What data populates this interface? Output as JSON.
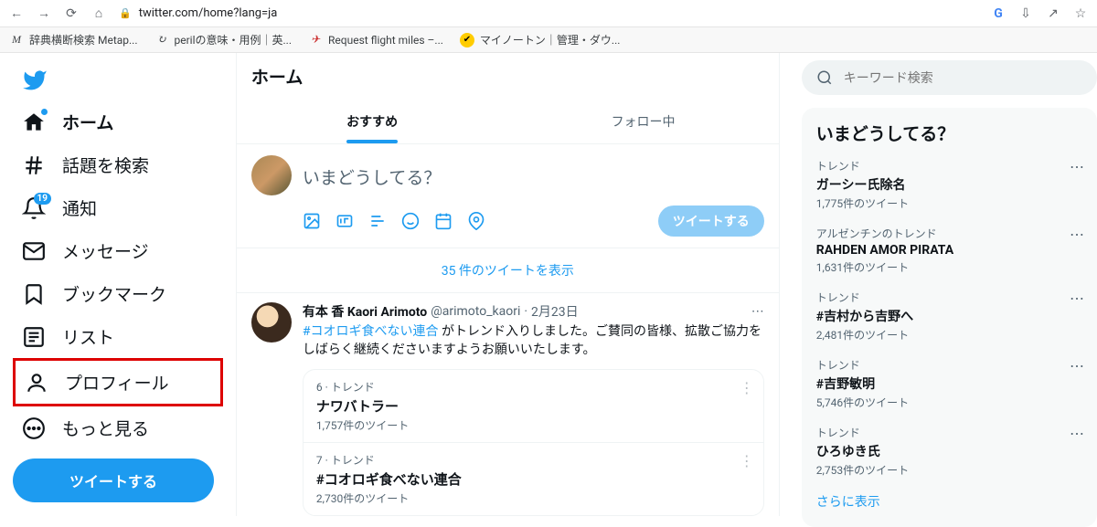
{
  "browser": {
    "url": "twitter.com/home?lang=ja",
    "bookmarks": [
      {
        "icon": "M",
        "label": "辞典横断検索 Metap..."
      },
      {
        "icon": "↻",
        "label": "perilの意味・用例｜英..."
      },
      {
        "icon": "✈",
        "label": "Request flight miles –..."
      },
      {
        "icon": "✔",
        "label": "マイノートン｜管理・ダウ..."
      }
    ]
  },
  "nav": {
    "home": "ホーム",
    "explore": "話題を検索",
    "notifications": "通知",
    "notifications_badge": "19",
    "messages": "メッセージ",
    "bookmarks": "ブックマーク",
    "lists": "リスト",
    "profile": "プロフィール",
    "more": "もっと見る",
    "tweet_button": "ツイートする"
  },
  "center": {
    "title": "ホーム",
    "tabs": {
      "for_you": "おすすめ",
      "following": "フォロー中"
    },
    "compose_placeholder": "いまどうしてる？",
    "tweet_button": "ツイートする",
    "show_new": "35 件のツイートを表示",
    "tweet": {
      "name": "有本 香 Kaori Arimoto",
      "handle": "@arimoto_kaori",
      "date": "2月23日",
      "hashtag": "#コオロギ食べない連合",
      "text_after": " がトレンド入りしました。ご賛同の皆様、拡散ご協力をしばらく継続くださいますようお願いいたします。"
    },
    "embedded_trends": [
      {
        "rank": "6 · トレンド",
        "name": "ナワバトラー",
        "count": "1,757件のツイート"
      },
      {
        "rank": "7 · トレンド",
        "name": "#コオロギ食べない連合",
        "count": "2,730件のツイート"
      }
    ]
  },
  "right": {
    "search_placeholder": "キーワード検索",
    "widget_title": "いまどうしてる？",
    "trends": [
      {
        "meta": "トレンド",
        "name": "ガーシー氏除名",
        "count": "1,775件のツイート"
      },
      {
        "meta": "アルゼンチンのトレンド",
        "name": "RAHDEN AMOR PIRATA",
        "count": "1,631件のツイート"
      },
      {
        "meta": "トレンド",
        "name": "#吉村から吉野へ",
        "count": "2,481件のツイート"
      },
      {
        "meta": "トレンド",
        "name": "#吉野敏明",
        "count": "5,746件のツイート"
      },
      {
        "meta": "トレンド",
        "name": "ひろゆき氏",
        "count": "2,753件のツイート"
      }
    ],
    "show_more": "さらに表示"
  }
}
